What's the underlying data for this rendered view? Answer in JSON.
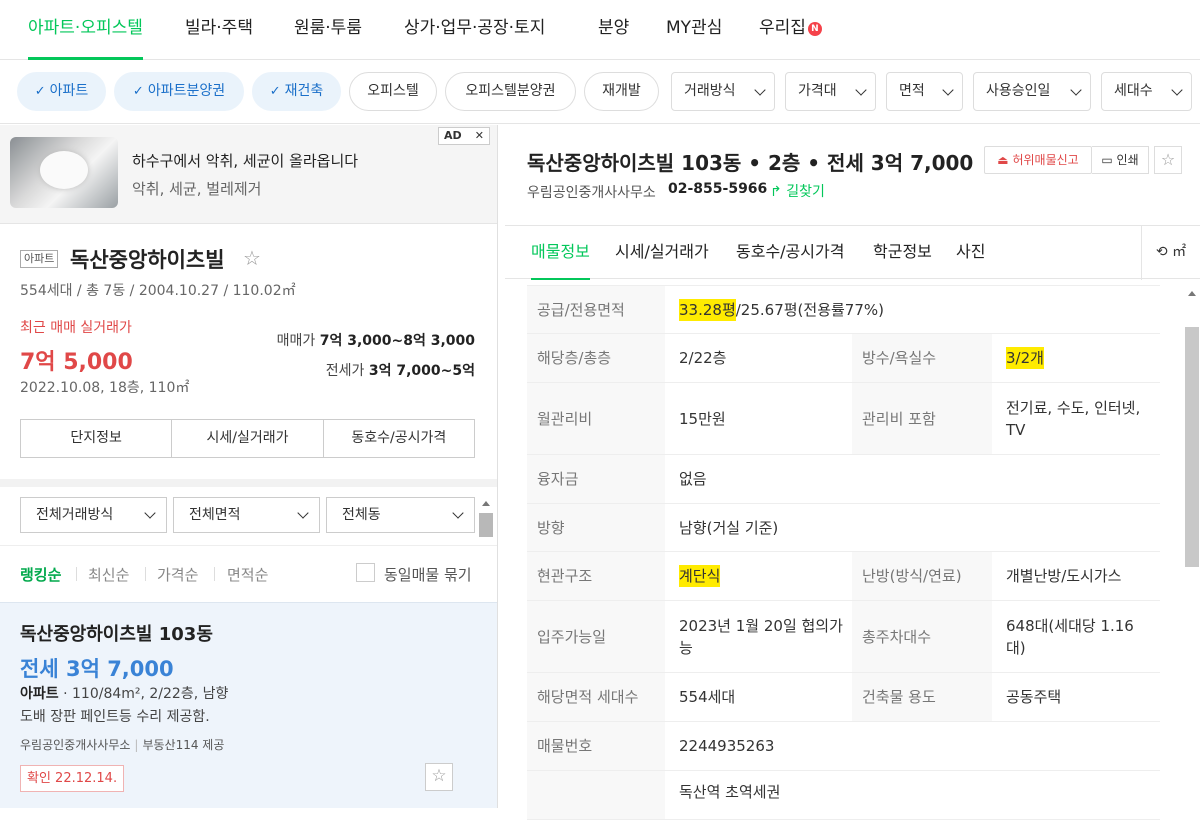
{
  "top_nav": {
    "tabs": [
      "아파트·오피스텔",
      "빌라·주택",
      "원룸·투룸",
      "상가·업무·공장·토지",
      "분양",
      "MY관심",
      "우리집"
    ],
    "new_badge": "N",
    "active_color": "#03c75a"
  },
  "filters": {
    "chips": [
      {
        "label": "아파트",
        "selected": true
      },
      {
        "label": "아파트분양권",
        "selected": true
      },
      {
        "label": "재건축",
        "selected": true
      },
      {
        "label": "오피스텔",
        "selected": false
      },
      {
        "label": "오피스텔분양권",
        "selected": false
      },
      {
        "label": "재개발",
        "selected": false
      }
    ],
    "dropdowns": [
      "거래방식",
      "가격대",
      "면적",
      "사용승인일",
      "세대수"
    ]
  },
  "ad": {
    "title": "하수구에서 악취, 세균이 올라옵니다",
    "subtitle": "악취, 세균, 벌레제거",
    "ad_label": "AD",
    "close_glyph": "✕"
  },
  "complex": {
    "type_badge": "아파트",
    "name": "독산중앙하이츠빌",
    "star_glyph": "☆",
    "info": "554세대 / 총 7동 / 2004.10.27 / 110.02㎡",
    "recent_label": "최근 매매 실거래가",
    "recent_price": "7억 5,000",
    "recent_date": "2022.10.08, 18층, 110㎡",
    "sale_label": "매매가",
    "sale_range": "7억 3,000~8억 3,000",
    "jeonse_label": "전세가",
    "jeonse_range": "3억 7,000~5억",
    "buttons": [
      "단지정보",
      "시세/실거래가",
      "동호수/공시가격"
    ]
  },
  "list_filters": [
    "전체거래방식",
    "전체면적",
    "전체동"
  ],
  "sort": {
    "options": [
      "랭킹순",
      "최신순",
      "가격순",
      "면적순"
    ],
    "group_label": "동일매물 묶기"
  },
  "listing": {
    "name": "독산중앙하이츠빌 103동",
    "price": "전세 3억 7,000",
    "type": "아파트",
    "info": "110/84m², 2/22층, 남향",
    "desc": "도배 장판 페인트등 수리 제공함.",
    "agent": "우림공인중개사사무소",
    "provider": "부동산114 제공",
    "confirmed": "확인 22.12.14."
  },
  "detail": {
    "title": "독산중앙하이츠빌 103동 • 2층 • 전세 3억 7,000",
    "agent": "우림공인중개사사무소",
    "phone": "02-855-5966",
    "route_label": "길찾기",
    "report_label": "허위매물신고",
    "print_label": "인쇄",
    "tabs": [
      "매물정보",
      "시세/실거래가",
      "동호수/공시가격",
      "학군정보",
      "사진"
    ],
    "unit_toggle": "㎡",
    "rows": [
      {
        "k1": "공급/전용면적",
        "v1a": "33.28평",
        "v1b": "/25.67평(전용률77%)"
      },
      {
        "k1": "해당층/총층",
        "v1": "2/22층",
        "k2": "방수/욕실수",
        "v2": "3/2개"
      },
      {
        "k1": "월관리비",
        "v1": "15만원",
        "k2": "관리비 포함",
        "v2": "전기료, 수도, 인터넷, TV"
      },
      {
        "k1": "융자금",
        "v1": "없음"
      },
      {
        "k1": "방향",
        "v1": "남향(거실 기준)"
      },
      {
        "k1": "현관구조",
        "v1": "계단식",
        "k2": "난방(방식/연료)",
        "v2": "개별난방/도시가스"
      },
      {
        "k1": "입주가능일",
        "v1": "2023년 1월 20일 협의가능",
        "k2": "총주차대수",
        "v2": "648대(세대당 1.16대)"
      },
      {
        "k1": "해당면적 세대수",
        "v1": "554세대",
        "k2": "건축물 용도",
        "v2": "공동주택"
      },
      {
        "k1": "매물번호",
        "v1": "2244935263"
      },
      {
        "k1": "",
        "v1": "독산역 초역세권"
      }
    ]
  }
}
